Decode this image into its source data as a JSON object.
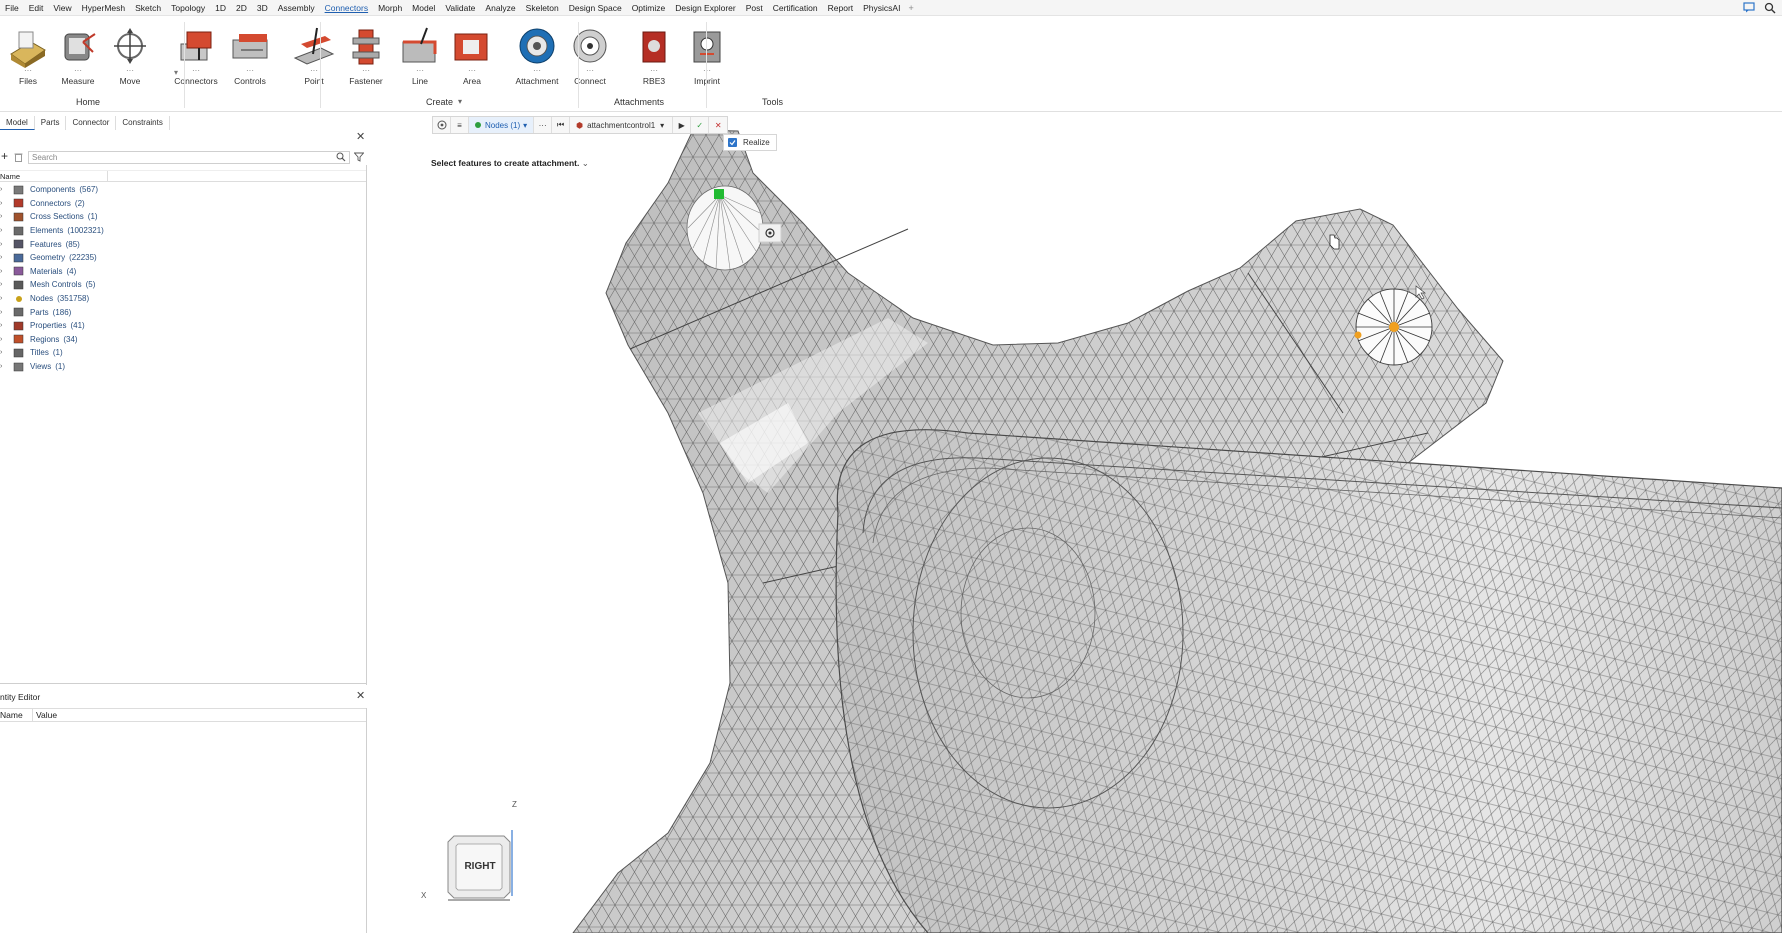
{
  "menubar": {
    "items": [
      "File",
      "Edit",
      "View",
      "HyperMesh",
      "Sketch",
      "Topology",
      "1D",
      "2D",
      "3D",
      "Assembly",
      "Connectors",
      "Morph",
      "Model",
      "Validate",
      "Analyze",
      "Skeleton",
      "Design Space",
      "Optimize",
      "Design Explorer",
      "Post",
      "Certification",
      "Report",
      "PhysicsAI"
    ],
    "active_index": 10
  },
  "ribbon": {
    "tools": [
      {
        "label": "Files",
        "icon": "files-icon"
      },
      {
        "label": "Measure",
        "icon": "measure-icon"
      },
      {
        "label": "Move",
        "icon": "move-icon"
      },
      {
        "label": "Connectors",
        "icon": "connectors-icon"
      },
      {
        "label": "Controls",
        "icon": "controls-icon"
      },
      {
        "label": "Point",
        "icon": "point-icon"
      },
      {
        "label": "Fastener",
        "icon": "fastener-icon"
      },
      {
        "label": "Line",
        "icon": "line-icon"
      },
      {
        "label": "Area",
        "icon": "area-icon"
      },
      {
        "label": "Attachment",
        "icon": "attachment-icon"
      },
      {
        "label": "Connect",
        "icon": "connect-icon"
      },
      {
        "label": "RBE3",
        "icon": "rbe3-icon"
      },
      {
        "label": "Imprint",
        "icon": "imprint-icon"
      }
    ],
    "groups": {
      "home": "Home",
      "create": "Create",
      "attachments": "Attachments",
      "tools": "Tools"
    }
  },
  "left_panel": {
    "tabs": [
      "Model",
      "Parts",
      "Connector",
      "Constraints"
    ],
    "search_placeholder": "Search",
    "column_name": "Name",
    "tree": [
      {
        "label": "Components",
        "count": "(567)",
        "icon": "components-icon"
      },
      {
        "label": "Connectors",
        "count": "(2)",
        "icon": "connectors-icon"
      },
      {
        "label": "Cross Sections",
        "count": "(1)",
        "icon": "cross-sections-icon"
      },
      {
        "label": "Elements",
        "count": "(1002321)",
        "icon": "elements-icon"
      },
      {
        "label": "Features",
        "count": "(85)",
        "icon": "features-icon"
      },
      {
        "label": "Geometry",
        "count": "(22235)",
        "icon": "geometry-icon"
      },
      {
        "label": "Materials",
        "count": "(4)",
        "icon": "materials-icon"
      },
      {
        "label": "Mesh Controls",
        "count": "(5)",
        "icon": "mesh-controls-icon"
      },
      {
        "label": "Nodes",
        "count": "(351758)",
        "icon": "nodes-icon"
      },
      {
        "label": "Parts",
        "count": "(186)",
        "icon": "parts-icon"
      },
      {
        "label": "Properties",
        "count": "(41)",
        "icon": "properties-icon"
      },
      {
        "label": "Regions",
        "count": "(34)",
        "icon": "regions-icon"
      },
      {
        "label": "Titles",
        "count": "(1)",
        "icon": "titles-icon"
      },
      {
        "label": "Views",
        "count": "(1)",
        "icon": "views-icon"
      }
    ],
    "entity_editor": {
      "title": "ntity Editor",
      "col_name": "Name",
      "col_value": "Value"
    }
  },
  "guidebar": {
    "selector_label": "Nodes (1)",
    "attachment_control": "attachmentcontrol1",
    "realize_label": "Realize",
    "realize_checked": true
  },
  "prompt": "Select features to create attachment.",
  "viewcube": {
    "face": "RIGHT",
    "axis_z": "Z",
    "axis_x": "X"
  },
  "colors": {
    "accent": "#1f5fb0",
    "mesh_fill": "#c8c8c8",
    "mesh_line": "#6f6f6f",
    "selected_node": "#22bb33",
    "highlight_node": "#f0a020"
  }
}
